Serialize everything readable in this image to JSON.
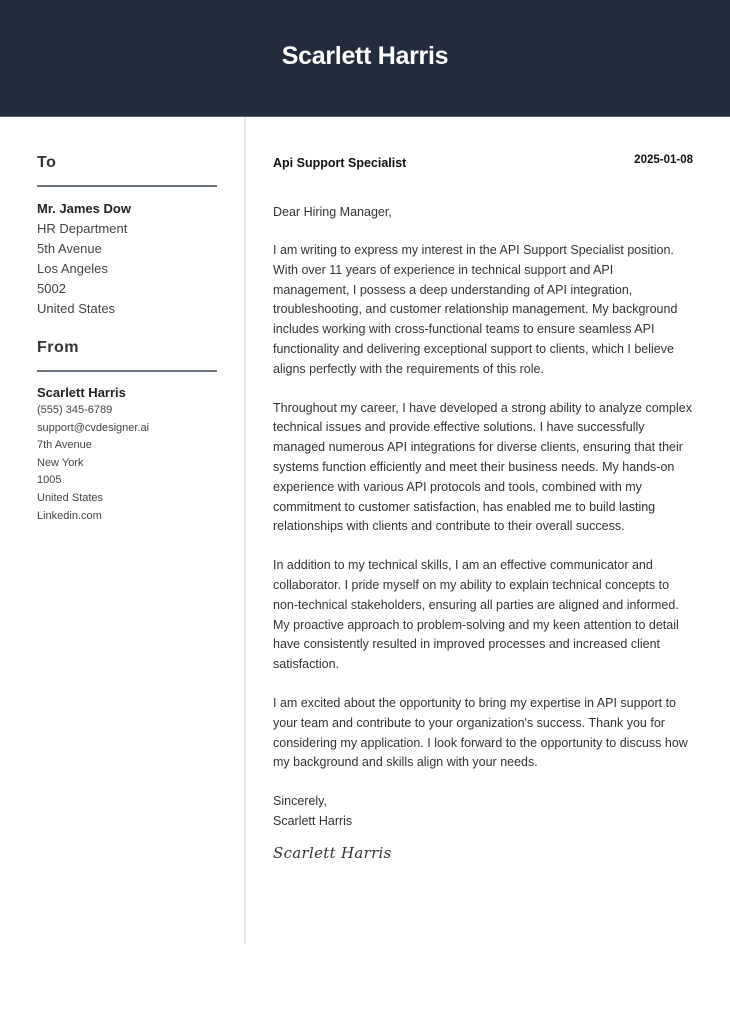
{
  "header": {
    "name": "Scarlett Harris"
  },
  "recipient": {
    "section_title": "To",
    "name": "Mr. James Dow",
    "lines": [
      "HR Department",
      "5th Avenue",
      "Los Angeles",
      "5002",
      "United States"
    ]
  },
  "sender": {
    "section_title": "From",
    "name": "Scarlett Harris",
    "lines": [
      "(555) 345-6789",
      "support@cvdesigner.ai",
      "7th Avenue",
      "New York",
      "1005",
      "United States",
      "Linkedin.com"
    ]
  },
  "letter": {
    "job_title": "Api Support Specialist",
    "date": "2025-01-08",
    "greeting": "Dear Hiring Manager,",
    "paragraphs": [
      "I am writing to express my interest in the API Support Specialist position. With over 11 years of experience in technical support and API management, I possess a deep understanding of API integration, troubleshooting, and customer relationship management. My background includes working with cross-functional teams to ensure seamless API functionality and delivering exceptional support to clients, which I believe aligns perfectly with the requirements of this role.",
      "Throughout my career, I have developed a strong ability to analyze complex technical issues and provide effective solutions. I have successfully managed numerous API integrations for diverse clients, ensuring that their systems function efficiently and meet their business needs. My hands-on experience with various API protocols and tools, combined with my commitment to customer satisfaction, has enabled me to build lasting relationships with clients and contribute to their overall success.",
      "In addition to my technical skills, I am an effective communicator and collaborator. I pride myself on my ability to explain technical concepts to non-technical stakeholders, ensuring all parties are aligned and informed. My proactive approach to problem-solving and my keen attention to detail have consistently resulted in improved processes and increased client satisfaction.",
      "I am excited about the opportunity to bring my expertise in API support to your team and contribute to your organization's success. Thank you for considering my application. I look forward to the opportunity to discuss how my background and skills align with your needs."
    ],
    "closing": "Sincerely,",
    "closing_name": "Scarlett Harris",
    "signature": "Scarlett Harris"
  },
  "colors": {
    "header_bg": "#232c3d",
    "rule": "#6b7280",
    "divider": "#e8e8e8"
  }
}
